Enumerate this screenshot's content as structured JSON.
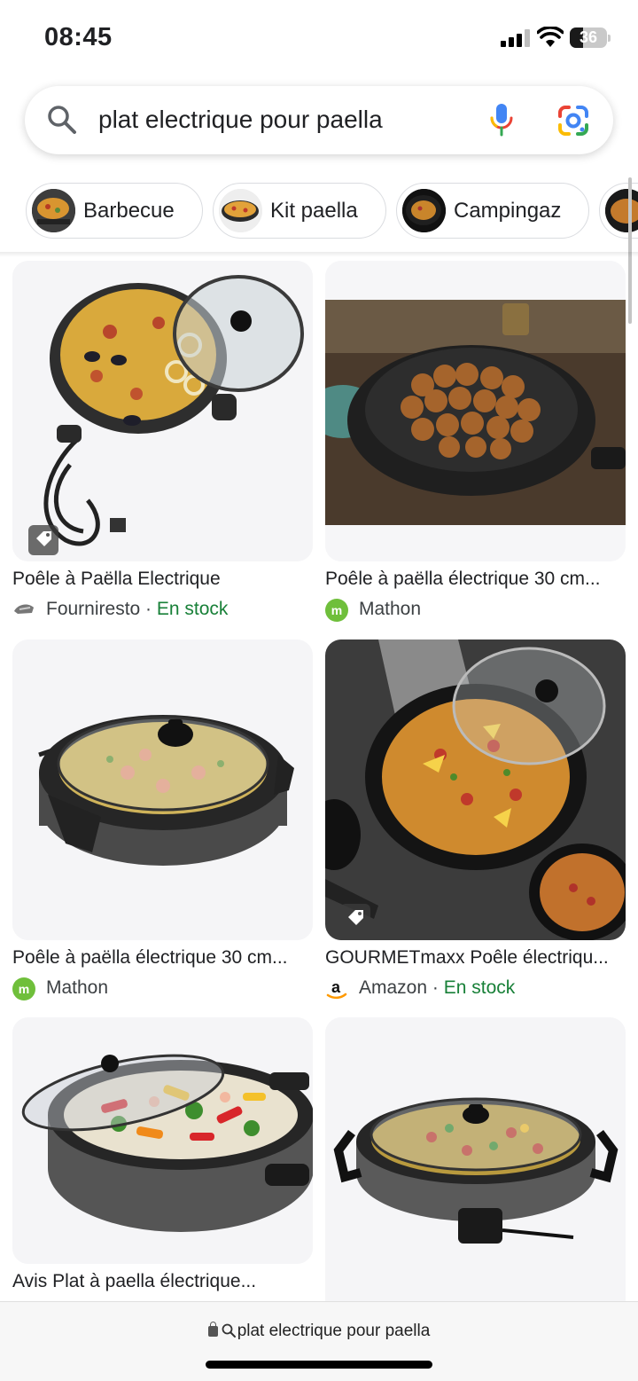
{
  "status_bar": {
    "time": "08:45",
    "battery": "36",
    "battery_level": 0.36
  },
  "search": {
    "query": "plat electrique pour paella"
  },
  "chips": [
    {
      "label": "Barbecue"
    },
    {
      "label": "Kit paella"
    },
    {
      "label": "Campingaz"
    }
  ],
  "results": [
    {
      "title": "Poêle à Paëlla Electrique",
      "source": "Fourniresto",
      "stock": "En stock",
      "has_tag": true
    },
    {
      "title": "Poêle à paëlla électrique 30 cm...",
      "source": "Mathon",
      "stock": "",
      "has_tag": false
    },
    {
      "title": "Poêle à paëlla électrique 30 cm...",
      "source": "Mathon",
      "stock": "",
      "has_tag": false
    },
    {
      "title": "GOURMETmaxx Poêle électriqu...",
      "source": "Amazon",
      "stock": "En stock",
      "has_tag": true
    },
    {
      "title": "Avis Plat à paella électrique...",
      "source": "",
      "stock": "",
      "has_tag": false
    },
    {
      "title": "",
      "source": "",
      "stock": "",
      "has_tag": false
    }
  ],
  "bottom_bar": {
    "url": "plat electrique pour paella"
  },
  "colors": {
    "stock_green": "#188038",
    "google_blue": "#4285F4",
    "google_red": "#EA4335",
    "google_yellow": "#FBBC04",
    "google_green": "#34A853"
  }
}
